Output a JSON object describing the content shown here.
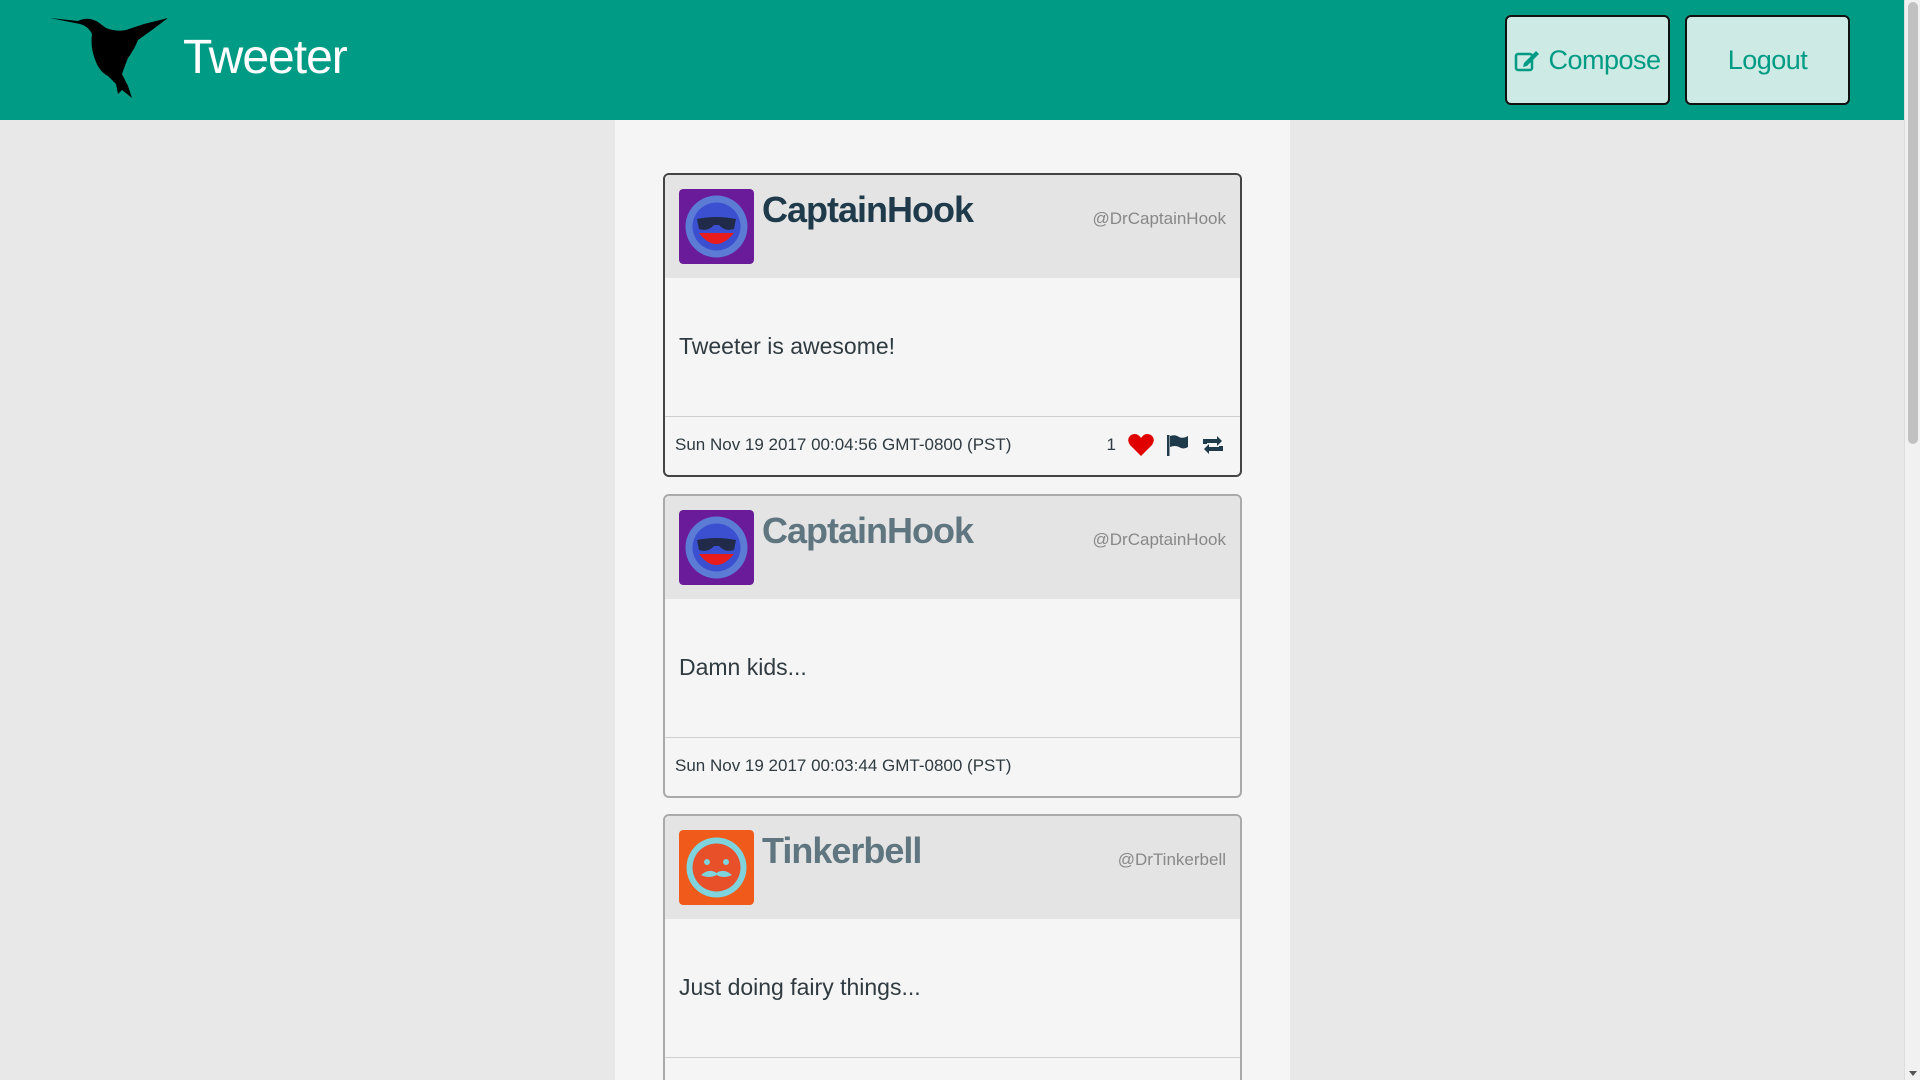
{
  "app": {
    "title": "Tweeter"
  },
  "nav": {
    "compose_label": "Compose",
    "logout_label": "Logout"
  },
  "colors": {
    "brand": "#009b85",
    "like": "#e00000",
    "name_active": "#1f3a4a",
    "name_muted": "#5f7680"
  },
  "tweets": [
    {
      "name": "CaptainHook",
      "handle": "@DrCaptainHook",
      "text": "Tweeter is awesome!",
      "date": "Sun Nov 19 2017 00:04:56 GMT-0800 (PST)",
      "likes": "1",
      "avatar": "purple-smiley-avatar"
    },
    {
      "name": "CaptainHook",
      "handle": "@DrCaptainHook",
      "text": "Damn kids...",
      "date": "Sun Nov 19 2017 00:03:44 GMT-0800 (PST)",
      "avatar": "purple-smiley-avatar"
    },
    {
      "name": "Tinkerbell",
      "handle": "@DrTinkerbell",
      "text": "Just doing fairy things...",
      "avatar": "orange-mustache-avatar"
    }
  ]
}
